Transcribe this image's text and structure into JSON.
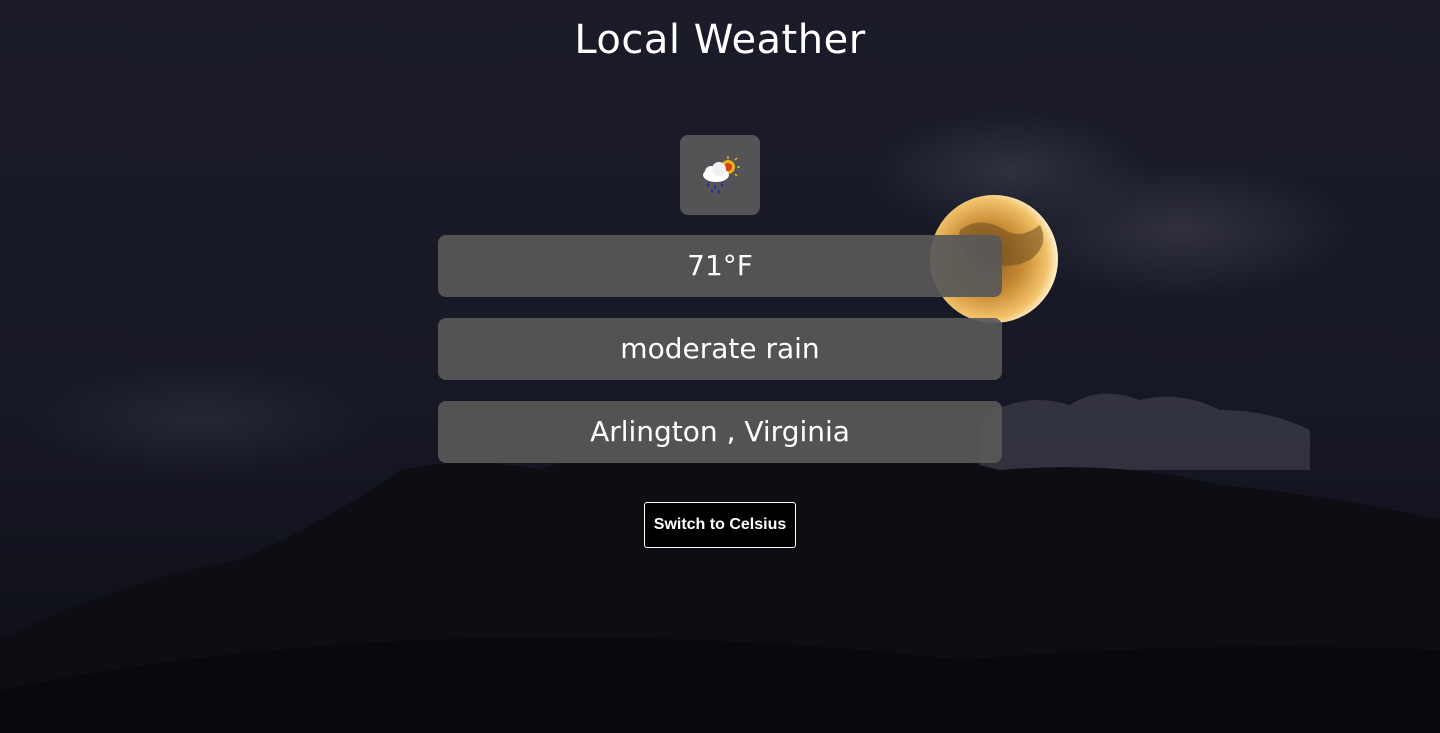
{
  "page": {
    "title": "Local Weather"
  },
  "weather": {
    "icon": "rain-cloud-sun-icon",
    "temperature": "71°F",
    "description": "moderate rain",
    "location": "Arlington , Virginia"
  },
  "controls": {
    "switch_unit_label": "Switch to Celsius"
  },
  "colors": {
    "sky": "#1c1c2b",
    "panel": "#585858",
    "moon": "#e8a93a",
    "button_bg": "#000000",
    "text": "#ffffff"
  }
}
